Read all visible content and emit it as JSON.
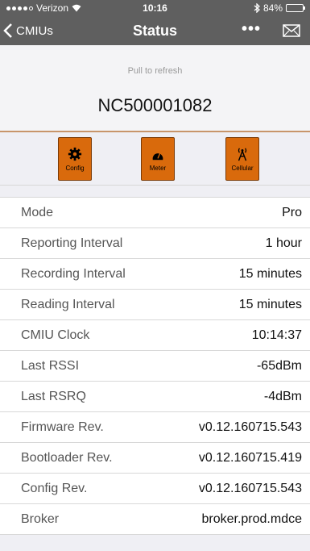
{
  "status_bar": {
    "carrier": "Verizon",
    "time": "10:16",
    "battery_text": "84%",
    "battery_level": 0.84
  },
  "nav": {
    "back_label": "CMIUs",
    "title": "Status",
    "more_label": "•••"
  },
  "header": {
    "pull_to_refresh": "Pull to refresh",
    "device_id": "NC500001082"
  },
  "tools": [
    {
      "label": "Config",
      "icon": "gear-icon"
    },
    {
      "label": "Meter",
      "icon": "meter-icon"
    },
    {
      "label": "Cellular",
      "icon": "cell-tower-icon"
    }
  ],
  "rows": [
    {
      "key": "Mode",
      "value": "Pro"
    },
    {
      "key": "Reporting Interval",
      "value": "1 hour"
    },
    {
      "key": "Recording Interval",
      "value": "15 minutes"
    },
    {
      "key": "Reading Interval",
      "value": "15 minutes"
    },
    {
      "key": "CMIU Clock",
      "value": "10:14:37"
    },
    {
      "key": "Last RSSI",
      "value": "-65dBm"
    },
    {
      "key": "Last RSRQ",
      "value": "-4dBm"
    },
    {
      "key": "Firmware Rev.",
      "value": "v0.12.160715.543"
    },
    {
      "key": "Bootloader Rev.",
      "value": "v0.12.160715.419"
    },
    {
      "key": "Config Rev.",
      "value": "v0.12.160715.543"
    },
    {
      "key": "Broker",
      "value": "broker.prod.mdce"
    }
  ]
}
